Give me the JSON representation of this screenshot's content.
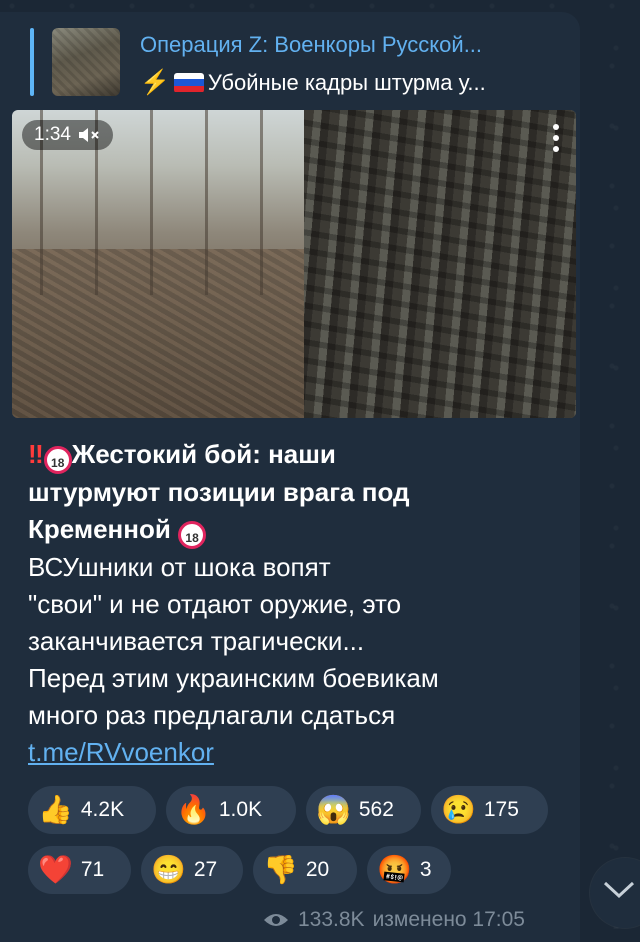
{
  "reply": {
    "title": "Операция Z: Военкоры Русской...",
    "subtitle": "Убойные кадры штурма у..."
  },
  "video": {
    "duration": "1:34"
  },
  "post": {
    "line1": "Жестокий бой: наши",
    "line2": "штурмуют позиции врага под",
    "line3": "Кременной",
    "line4": "ВСУшники от шока вопят",
    "line5": "\"свои\" и не отдают оружие, это",
    "line6": "заканчивается трагически...",
    "line7": "Перед этим украинским боевикам",
    "line8": "много раз предлагали сдаться",
    "link": "t.me/RVvoenkor",
    "badge": "18"
  },
  "reactions": [
    {
      "emoji": "👍",
      "count": "4.2K"
    },
    {
      "emoji": "🔥",
      "count": "1.0K"
    },
    {
      "emoji": "😱",
      "count": "562"
    },
    {
      "emoji": "😢",
      "count": "175"
    },
    {
      "emoji": "❤️",
      "count": "71"
    },
    {
      "emoji": "😁",
      "count": "27"
    },
    {
      "emoji": "👎",
      "count": "20"
    },
    {
      "emoji": "🤬",
      "count": "3"
    }
  ],
  "meta": {
    "views": "133.8K",
    "edited": "изменено 17:05"
  },
  "colors": {
    "background": "#1b2735",
    "bubble": "#1f2d3d",
    "accent": "#62b1f0",
    "reaction_bg": "#2f3f52"
  }
}
